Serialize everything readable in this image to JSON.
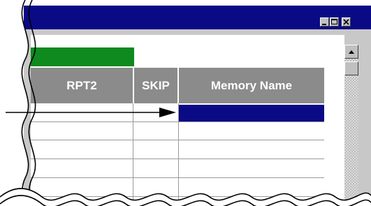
{
  "window": {
    "controls": [
      {
        "name": "minimize",
        "icon": "minimize-icon"
      },
      {
        "name": "maximize",
        "icon": "maximize-icon"
      },
      {
        "name": "close",
        "icon": "close-icon"
      }
    ],
    "title_bar_color": "#0a0a86"
  },
  "table": {
    "columns": [
      {
        "label": "RPT2"
      },
      {
        "label": "SKIP"
      },
      {
        "label": "Memory Name"
      }
    ],
    "header_color": "#8b8b8b",
    "highlight_cell_color": "#0f8a1e",
    "selected_row_color": "#0a0a86"
  },
  "scrollbar": {
    "up_icon": "triangle-up-icon"
  },
  "annotation": {
    "arrow_icon": "arrow-right-icon",
    "break_lines": "wavy-break-lines"
  }
}
